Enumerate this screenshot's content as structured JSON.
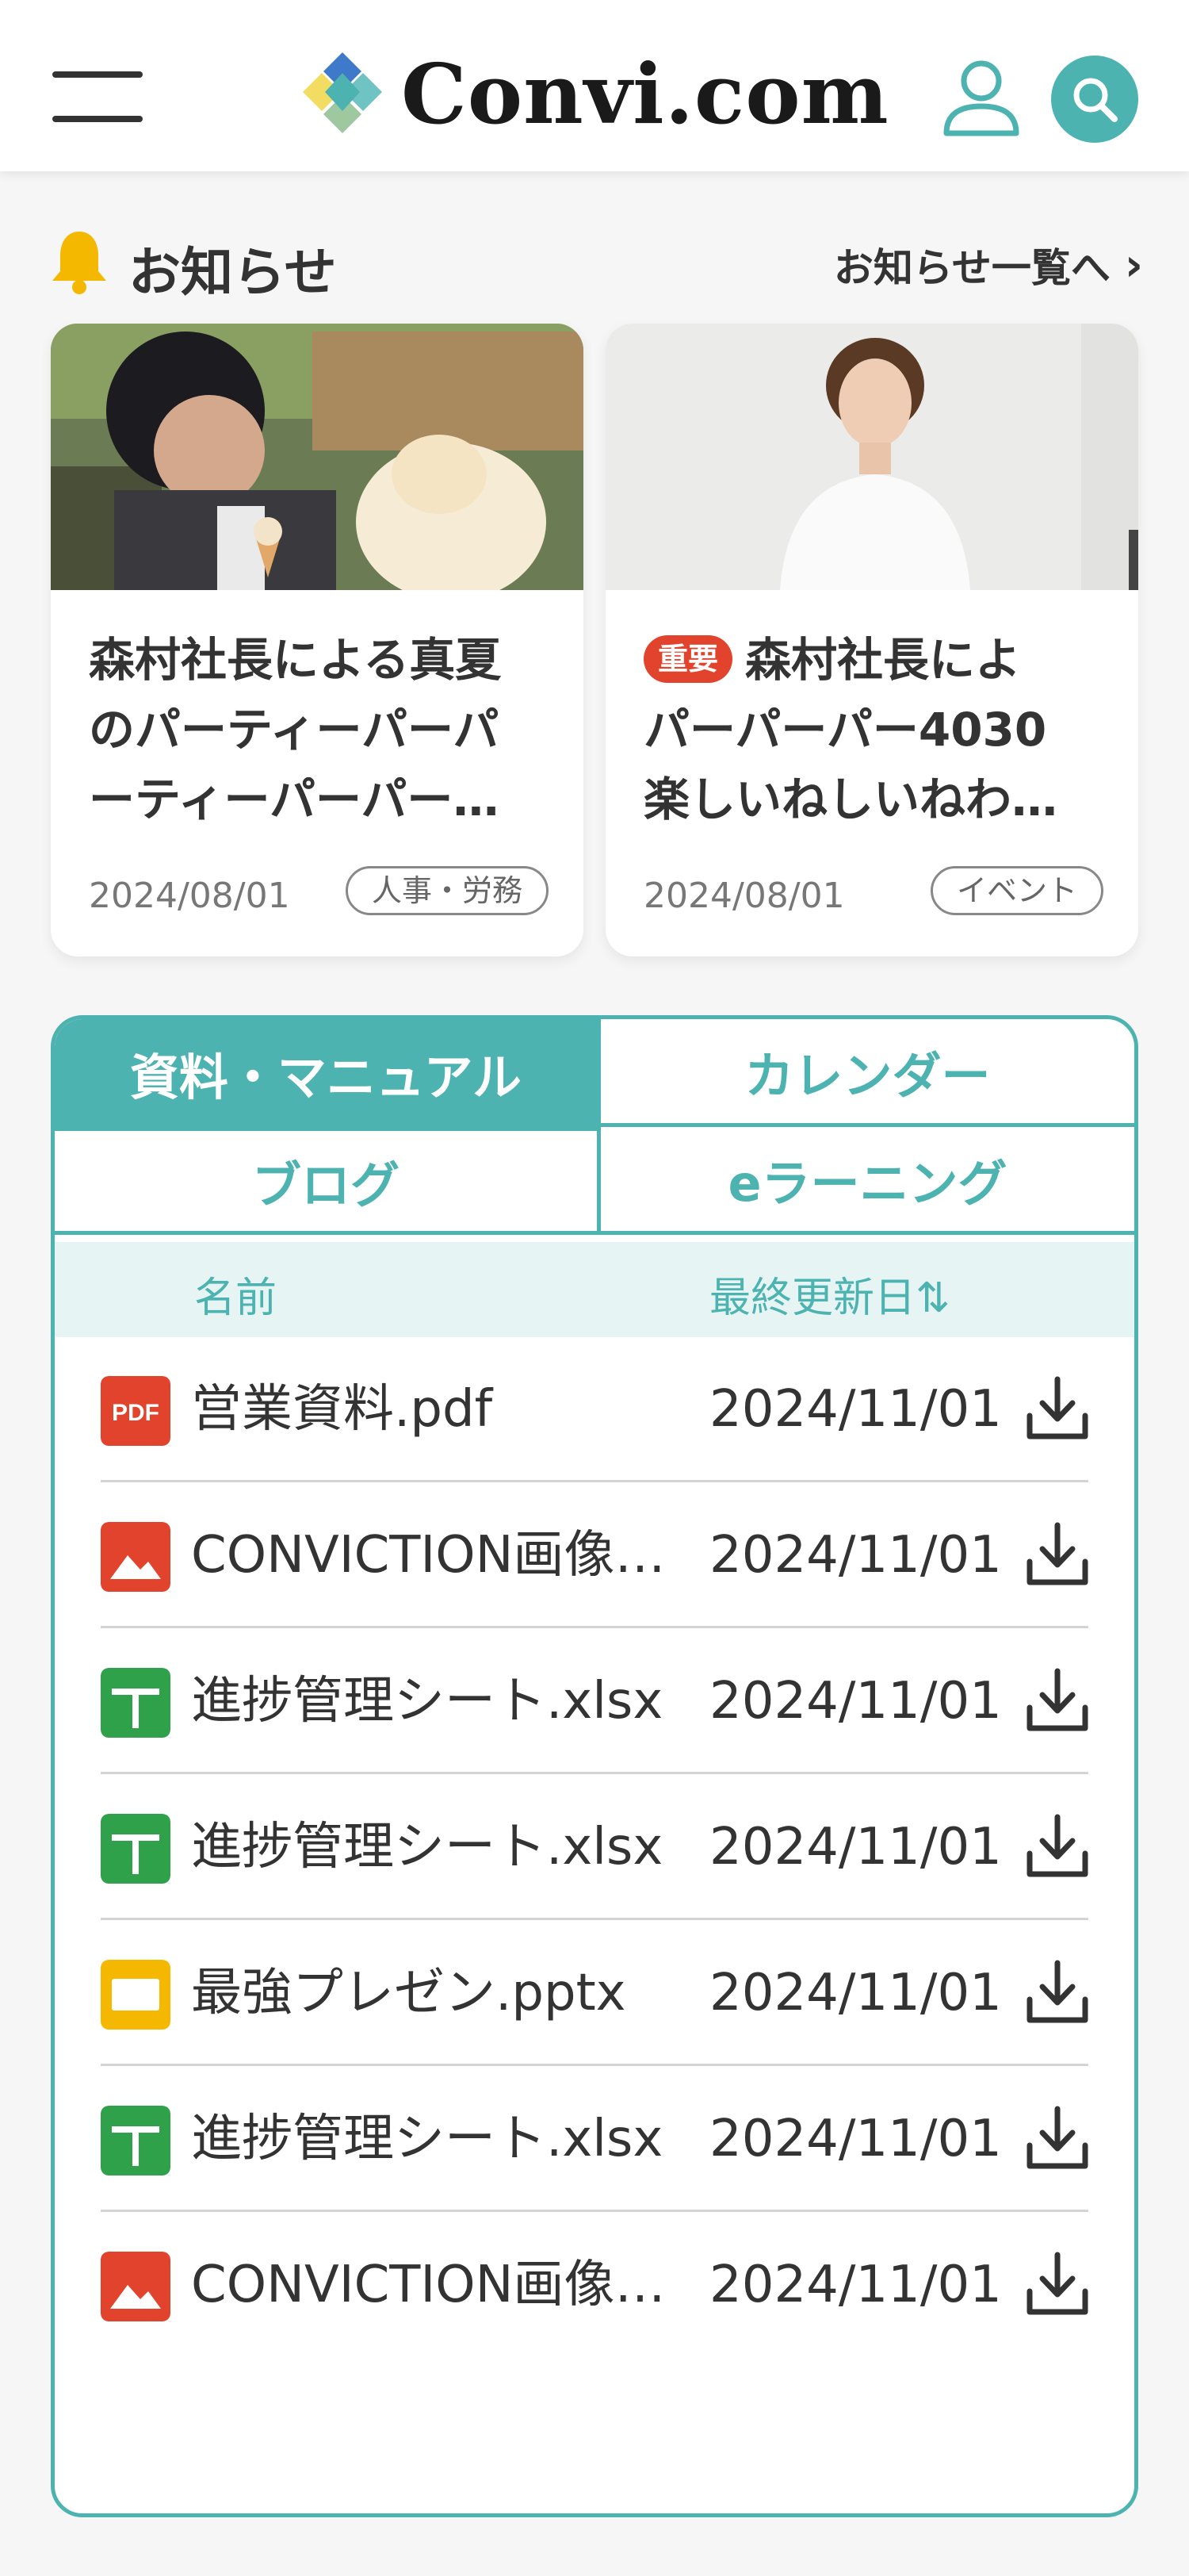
{
  "header": {
    "logo_text": "Convi.com",
    "menu_icon": "hamburger-menu-icon",
    "user_icon": "user-icon",
    "search_icon": "search-icon",
    "accent": "#4cb3b0"
  },
  "notices": {
    "title": "お知らせ",
    "view_all": "お知らせ一覧へ",
    "view_all_chevron": "›",
    "cards": [
      {
        "lines": [
          "森村社長による真夏",
          "のパーティーパーパ",
          "ーティーパーパー…"
        ],
        "important": "",
        "date": "2024/08/01",
        "tag": "人事・労務"
      },
      {
        "lines": [
          "森村社長によ",
          "パーパーパー4030",
          "楽しいねしいねわ…"
        ],
        "important": "重要",
        "date": "2024/08/01",
        "tag": "イベント"
      }
    ]
  },
  "panel": {
    "tabs": [
      "資料・マニュアル",
      "カレンダー",
      "ブログ",
      "eラーニング"
    ],
    "active_tab": "資料・マニュアル",
    "col_name": "名前",
    "col_date": "最終更新日",
    "sort_glyph": "⇅",
    "files": [
      {
        "name": "営業資料.pdf",
        "date": "2024/11/01",
        "type": "pdf"
      },
      {
        "name": "CONVICTION画像…",
        "date": "2024/11/01",
        "type": "image"
      },
      {
        "name": "進捗管理シート.xlsx",
        "date": "2024/11/01",
        "type": "sheet"
      },
      {
        "name": "進捗管理シート.xlsx",
        "date": "2024/11/01",
        "type": "sheet"
      },
      {
        "name": "最強プレゼン.pptx",
        "date": "2024/11/01",
        "type": "slides"
      },
      {
        "name": "進捗管理シート.xlsx",
        "date": "2024/11/01",
        "type": "sheet"
      },
      {
        "name": "CONVICTION画像…",
        "date": "2024/11/01",
        "type": "image"
      }
    ],
    "pdf_label": "PDF"
  },
  "colors": {
    "teal": "#4cb3b0",
    "pdf": "#e2432c",
    "image": "#e2432c",
    "sheet": "#2fa14a",
    "slides": "#f5b800",
    "important_badge": "#e2432c"
  }
}
